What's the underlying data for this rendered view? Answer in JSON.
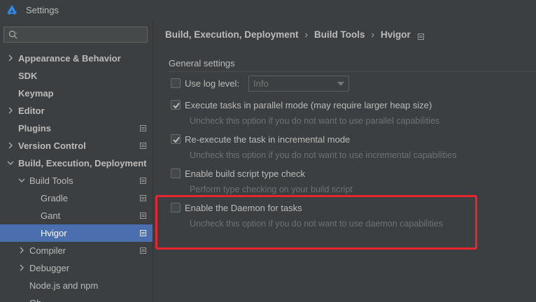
{
  "window": {
    "title": "Settings",
    "logo_icon": "harmony-logo-icon"
  },
  "search": {
    "placeholder": "",
    "value": ""
  },
  "sidebar": {
    "items": [
      {
        "label": "Appearance & Behavior",
        "bold": true,
        "depth": 0,
        "chevron": "right",
        "project_icon": false,
        "selected": false
      },
      {
        "label": "SDK",
        "bold": true,
        "depth": 0,
        "chevron": "none",
        "project_icon": false,
        "selected": false
      },
      {
        "label": "Keymap",
        "bold": true,
        "depth": 0,
        "chevron": "none",
        "project_icon": false,
        "selected": false
      },
      {
        "label": "Editor",
        "bold": true,
        "depth": 0,
        "chevron": "right",
        "project_icon": false,
        "selected": false
      },
      {
        "label": "Plugins",
        "bold": true,
        "depth": 0,
        "chevron": "none",
        "project_icon": true,
        "selected": false
      },
      {
        "label": "Version Control",
        "bold": true,
        "depth": 0,
        "chevron": "right",
        "project_icon": true,
        "selected": false
      },
      {
        "label": "Build, Execution, Deployment",
        "bold": true,
        "depth": 0,
        "chevron": "down",
        "project_icon": false,
        "selected": false
      },
      {
        "label": "Build Tools",
        "bold": false,
        "depth": 1,
        "chevron": "down",
        "project_icon": true,
        "selected": false
      },
      {
        "label": "Gradle",
        "bold": false,
        "depth": 2,
        "chevron": "none",
        "project_icon": true,
        "selected": false
      },
      {
        "label": "Gant",
        "bold": false,
        "depth": 2,
        "chevron": "none",
        "project_icon": true,
        "selected": false
      },
      {
        "label": "Hvigor",
        "bold": false,
        "depth": 2,
        "chevron": "none",
        "project_icon": true,
        "selected": true
      },
      {
        "label": "Compiler",
        "bold": false,
        "depth": 1,
        "chevron": "right",
        "project_icon": true,
        "selected": false
      },
      {
        "label": "Debugger",
        "bold": false,
        "depth": 1,
        "chevron": "right",
        "project_icon": false,
        "selected": false
      },
      {
        "label": "Node.js and npm",
        "bold": false,
        "depth": 1,
        "chevron": "none",
        "project_icon": false,
        "selected": false
      },
      {
        "label": "Oh",
        "bold": false,
        "depth": 1,
        "chevron": "none",
        "project_icon": false,
        "selected": false
      }
    ]
  },
  "breadcrumb": {
    "parts": [
      "Build, Execution, Deployment",
      "Build Tools",
      "Hvigor"
    ],
    "separator": "›"
  },
  "main": {
    "section_title": "General settings",
    "log_level": {
      "label": "Use log level:",
      "checked": false,
      "value": "Info"
    },
    "options": [
      {
        "label": "Execute tasks in parallel mode (may require larger heap size)",
        "checked": true,
        "hint": "Uncheck this option if you do not want to use parallel capabilities"
      },
      {
        "label": "Re-execute the task in incremental mode",
        "checked": true,
        "hint": "Uncheck this option if you do not want to use incremental capabilities"
      },
      {
        "label": "Enable build script type check",
        "checked": false,
        "hint": "Perform type checking on your build script"
      },
      {
        "label": "Enable the Daemon for tasks",
        "checked": false,
        "hint": "Uncheck this option if you do not want to use daemon capabilities"
      }
    ]
  },
  "colors": {
    "background": "#3c3f41",
    "selection": "#4b6eaf",
    "highlight_box": "#e8262f",
    "text": "#bbbbbb",
    "hint_text": "#6e7275"
  }
}
